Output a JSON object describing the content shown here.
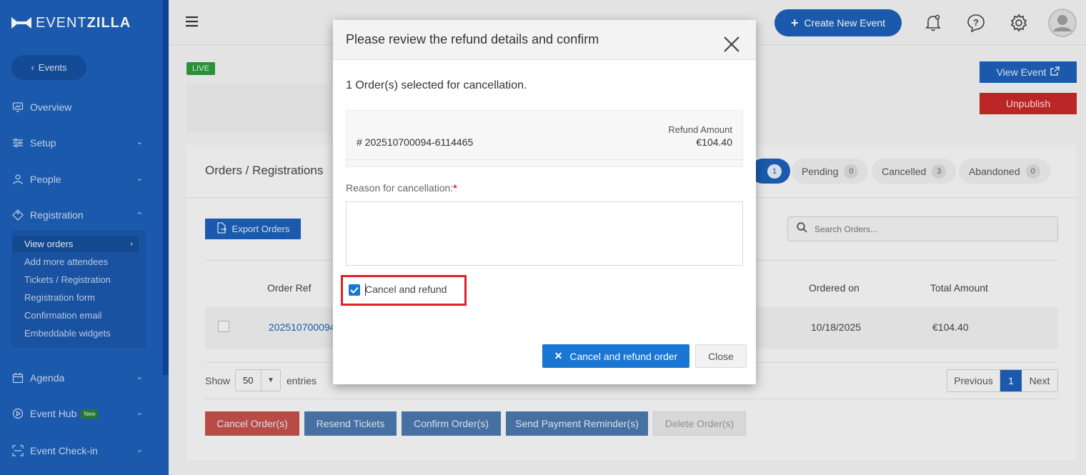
{
  "app": {
    "logo_light": "EVENT",
    "logo_bold": "ZILLA"
  },
  "sidebar": {
    "back_label": "Events",
    "items": [
      {
        "label": "Overview"
      },
      {
        "label": "Setup"
      },
      {
        "label": "People"
      },
      {
        "label": "Registration"
      },
      {
        "label": "Agenda"
      },
      {
        "label": "Event Hub",
        "badge": "New"
      },
      {
        "label": "Event Check-in"
      }
    ],
    "registration_sub": [
      {
        "label": "View orders"
      },
      {
        "label": "Add more attendees"
      },
      {
        "label": "Tickets / Registration"
      },
      {
        "label": "Registration form"
      },
      {
        "label": "Confirmation email"
      },
      {
        "label": "Embeddable widgets"
      }
    ]
  },
  "header": {
    "create_label": "Create New Event"
  },
  "event": {
    "status": "LIVE",
    "view_label": "View Event",
    "unpublish_label": "Unpublish"
  },
  "orders": {
    "title": "Orders / Registrations",
    "tabs": [
      {
        "label": "",
        "count": "1"
      },
      {
        "label": "Pending",
        "count": "0"
      },
      {
        "label": "Cancelled",
        "count": "3"
      },
      {
        "label": "Abandoned",
        "count": "0"
      }
    ],
    "export_label": "Export Orders",
    "search_placeholder": "Search Orders...",
    "columns": {
      "ref": "Order Ref",
      "ordered_on": "Ordered on",
      "total": "Total Amount"
    },
    "row": {
      "ref": "202510700094",
      "ordered_on": "10/18/2025",
      "total": "€104.40"
    },
    "show_label": "Show",
    "entries_value": "50",
    "entries_label": "entries",
    "pager": {
      "prev": "Previous",
      "page": "1",
      "next": "Next"
    },
    "actions": {
      "cancel": "Cancel Order(s)",
      "resend": "Resend Tickets",
      "confirm": "Confirm Order(s)",
      "reminder": "Send Payment Reminder(s)",
      "delete": "Delete Order(s)"
    }
  },
  "modal": {
    "title": "Please review the refund details and confirm",
    "selected_text": "1 Order(s) selected for cancellation.",
    "order_id": "# 202510700094-6114465",
    "refund_label": "Refund Amount",
    "refund_amount": "€104.40",
    "reason_label": "Reason for cancellation:",
    "required_mark": "*",
    "reason_value": "",
    "checkbox_label": "Cancel and refund",
    "checkbox_checked": true,
    "primary_label": "Cancel and refund order",
    "close_label": "Close"
  },
  "colors": {
    "brand_blue": "#1c5fb7",
    "danger": "#c62828",
    "success": "#2e9b3c",
    "highlight": "#e0202a"
  }
}
